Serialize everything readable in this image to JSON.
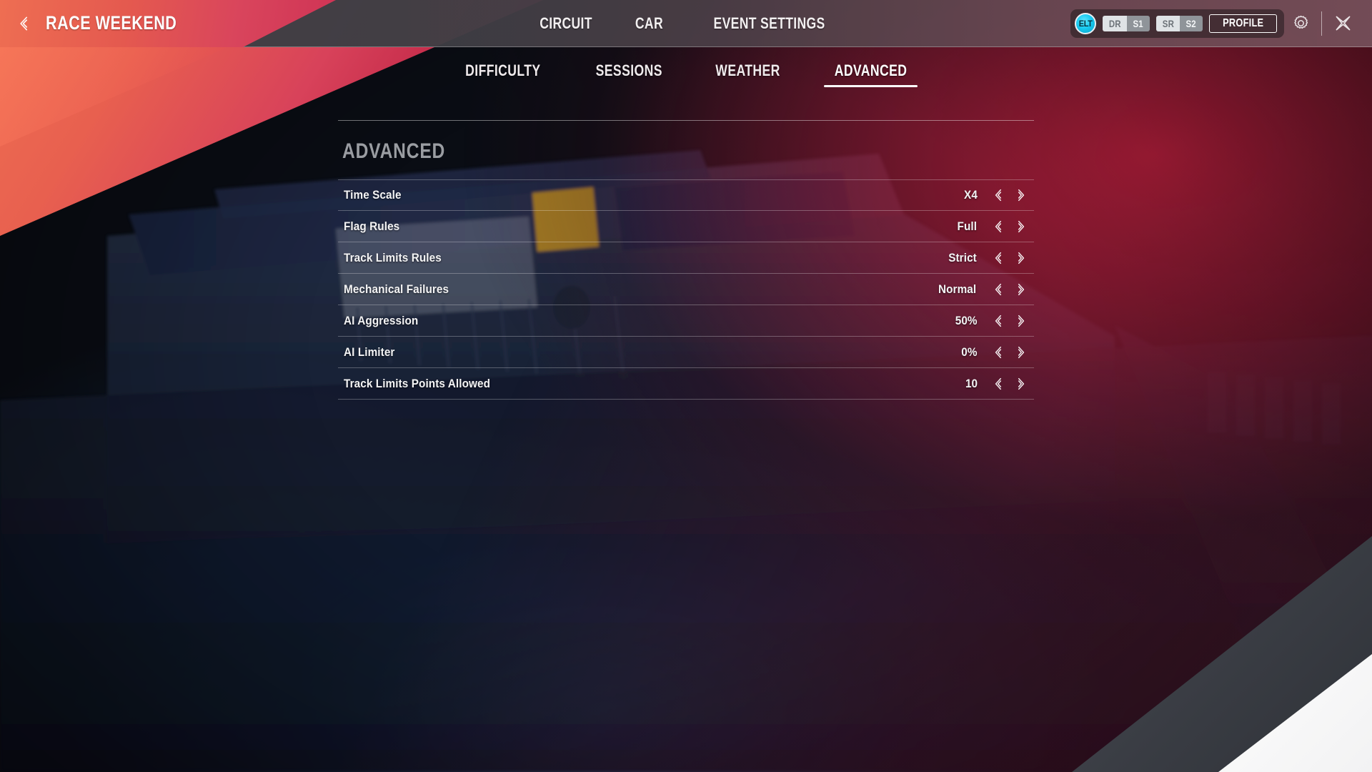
{
  "header": {
    "back_icon": "chevron-left-icon",
    "title": "RACE WEEKEND",
    "nav": [
      {
        "label": "CIRCUIT"
      },
      {
        "label": "CAR"
      },
      {
        "label": "EVENT SETTINGS"
      }
    ],
    "profile": {
      "avatar_text": "ELT",
      "stats": [
        {
          "key": "DR",
          "value": "S1"
        },
        {
          "key": "SR",
          "value": "S2"
        }
      ],
      "button_label": "PROFILE"
    },
    "settings_icon": "gear-icon",
    "close_icon": "close-icon"
  },
  "tabs": [
    {
      "label": "DIFFICULTY",
      "active": false
    },
    {
      "label": "SESSIONS",
      "active": false
    },
    {
      "label": "WEATHER",
      "active": false
    },
    {
      "label": "ADVANCED",
      "active": true
    }
  ],
  "panel": {
    "title": "ADVANCED",
    "settings": [
      {
        "label": "Time Scale",
        "value": "X4"
      },
      {
        "label": "Flag Rules",
        "value": "Full"
      },
      {
        "label": "Track Limits Rules",
        "value": "Strict"
      },
      {
        "label": "Mechanical Failures",
        "value": "Normal"
      },
      {
        "label": "AI Aggression",
        "value": "50%"
      },
      {
        "label": "AI Limiter",
        "value": "0%"
      },
      {
        "label": "Track Limits Points Allowed",
        "value": "10"
      }
    ],
    "prev_icon": "chevron-left-double-icon",
    "next_icon": "chevron-right-double-icon"
  },
  "colors": {
    "accent_red": "#c4203e",
    "accent_orange": "#ee6e52",
    "active_tab": "#ffffff",
    "panel_title": "#9a9da2",
    "avatar_cyan": "#16c8ef"
  }
}
